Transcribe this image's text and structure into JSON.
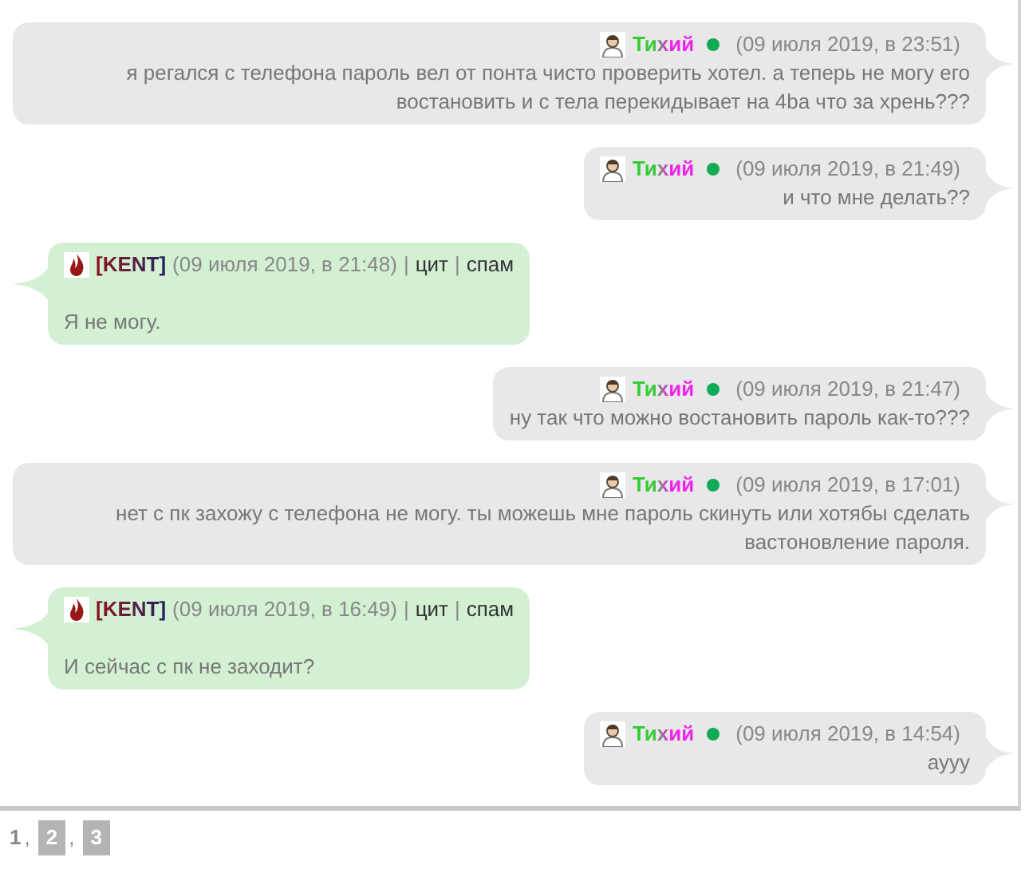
{
  "messages": [
    {
      "kind": "out",
      "author": "Тихий",
      "online": true,
      "time": "(09 июля 2019, в 23:51)",
      "text": "я регался с телефона пароль вел от понта чисто проверить хотел. а теперь не могу его востановить и с тела перекидывает на 4ba что за хрень???"
    },
    {
      "kind": "out",
      "author": "Тихий",
      "online": true,
      "time": "(09 июля 2019, в 21:49)",
      "text": "и что мне делать??"
    },
    {
      "kind": "in",
      "author": "[KENT]",
      "online": false,
      "time": "(09 июля 2019, в 21:48)",
      "actions": [
        {
          "sep": "|",
          "label": "цит"
        },
        {
          "sep": "|",
          "label": "спам"
        }
      ],
      "text": "Я не могу."
    },
    {
      "kind": "out",
      "author": "Тихий",
      "online": true,
      "time": "(09 июля 2019, в 21:47)",
      "text": "ну так что можно востановить пароль как-то???"
    },
    {
      "kind": "out",
      "author": "Тихий",
      "online": true,
      "time": "(09 июля 2019, в 17:01)",
      "text": "нет с пк захожу с телефона не могу. ты можешь мне пароль скинуть или хотябы сделать вастоновление пароля."
    },
    {
      "kind": "in",
      "author": "[KENT]",
      "online": false,
      "time": "(09 июля 2019, в 16:49)",
      "actions": [
        {
          "sep": "|",
          "label": "цит"
        },
        {
          "sep": "|",
          "label": "спам"
        }
      ],
      "text": "И сейчас с пк не заходит?"
    },
    {
      "kind": "out",
      "author": "Тихий",
      "online": true,
      "time": "(09 июля 2019, в 14:54)",
      "text": "аууу"
    }
  ],
  "pagination": [
    {
      "label": "1",
      "selected": true,
      "sep": ","
    },
    {
      "label": "2",
      "selected": false,
      "sep": ","
    },
    {
      "label": "3",
      "selected": false
    }
  ]
}
